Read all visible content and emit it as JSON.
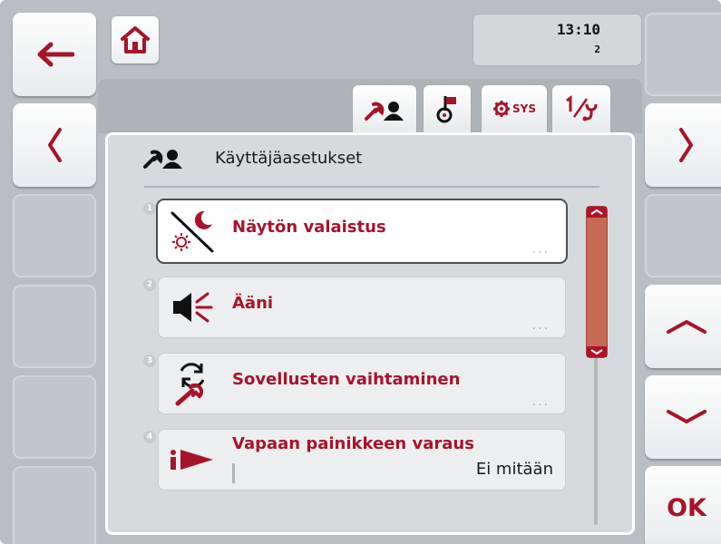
{
  "header": {
    "time": "13:10",
    "sub_indicator": "2"
  },
  "tabs": [
    {
      "icon": "user-settings-icon",
      "active": true
    },
    {
      "icon": "country-settings-icon",
      "active": false
    },
    {
      "icon": "system-settings-icon",
      "label": "SYS",
      "active": false
    },
    {
      "icon": "info-diagnostics-icon",
      "active": false
    }
  ],
  "panel": {
    "title": "Käyttäjäasetukset",
    "title_icon": "user-settings-icon"
  },
  "items": [
    {
      "number": "1",
      "label": "Näytön valaistus",
      "icon": "display-brightness-icon",
      "more": "...",
      "selected": true
    },
    {
      "number": "2",
      "label": "Ääni",
      "icon": "speaker-icon",
      "more": "..."
    },
    {
      "number": "3",
      "label": "Sovellusten vaihtaminen",
      "icon": "app-switch-icon",
      "more": "..."
    },
    {
      "number": "4",
      "label": "Vapaan painikkeen varaus",
      "icon": "info-arrow-icon",
      "value": "Ei mitään"
    }
  ],
  "softkeys": {
    "left": [
      "back-arrow-icon",
      "chevron-left-icon",
      "",
      "",
      "",
      ""
    ],
    "right": [
      "",
      "chevron-right-icon",
      "",
      "chevron-up-icon",
      "chevron-down-icon",
      "OK"
    ],
    "ok_label": "OK"
  },
  "colors": {
    "accent": "#a7142a",
    "background": "#b9bec3",
    "panel": "#d6dadd",
    "scroll_thumb": "#c66a55"
  }
}
